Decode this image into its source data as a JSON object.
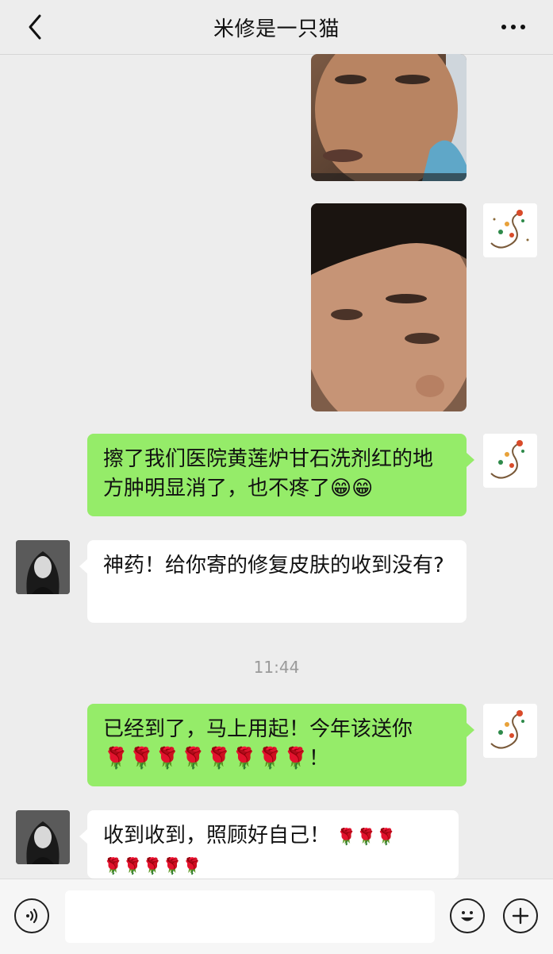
{
  "header": {
    "title": "米修是一只猫"
  },
  "messages": {
    "m1": {
      "text": "擦了我们医院黄莲炉甘石洗剂红的地方肿明显消了，也不疼了",
      "emoji": "😁😁"
    },
    "m2": {
      "text": "神药！给你寄的修复皮肤的收到没有?"
    },
    "timestamp": "11:44",
    "m3": {
      "text": "已经到了，马上用起！今年该送你",
      "roses": "🌹🌹🌹🌹🌹🌹🌹🌹",
      "end": "！"
    },
    "m4": {
      "text": "收到收到，照顾好自己！",
      "roses_line1": "🌹🌹🌹",
      "roses_line2": "🌹🌹🌹🌹🌹"
    }
  },
  "icons": {
    "back": "chevron-left-icon",
    "more": "more-dots-icon",
    "voice": "voice-icon",
    "emoji": "emoji-icon",
    "add": "plus-icon"
  },
  "colors": {
    "bubble_sent": "#95ec69",
    "bubble_received": "#ffffff",
    "background": "#ededed"
  }
}
